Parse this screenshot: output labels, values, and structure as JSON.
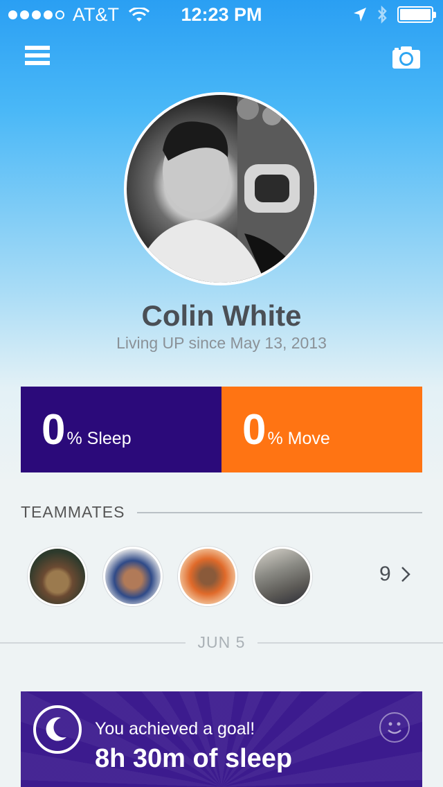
{
  "status_bar": {
    "carrier": "AT&T",
    "time": "12:23 PM",
    "signal_bars": 4,
    "signal_total": 5
  },
  "nav": {
    "menu_icon": "hamburger-menu-icon",
    "camera_icon": "camera-icon"
  },
  "profile": {
    "name": "Colin White",
    "since": "Living UP since May 13, 2013"
  },
  "stats": {
    "sleep": {
      "value": "0",
      "label": "% Sleep",
      "color": "#2b0a7a"
    },
    "move": {
      "value": "0",
      "label": "% Move",
      "color": "#ff7413"
    }
  },
  "teammates": {
    "title": "TEAMMATES",
    "count": "9"
  },
  "feed": {
    "date": "JUN 5",
    "goal": {
      "title": "You achieved a goal!",
      "value": "8h 30m of sleep",
      "icon": "moon-icon",
      "action_icon": "smiley-icon",
      "color": "#3c1b8e"
    }
  }
}
